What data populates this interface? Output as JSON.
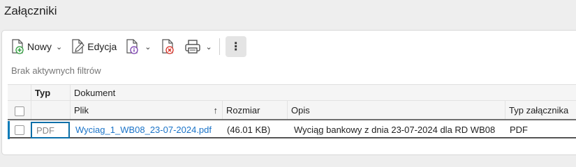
{
  "page": {
    "title": "Załączniki"
  },
  "toolbar": {
    "new_label": "Nowy",
    "edit_label": "Edycja",
    "accent": "#2e9e3c",
    "delete_color": "#d93025",
    "info_color": "#7b3fb0"
  },
  "filters": {
    "text": "Brak aktywnych filtrów"
  },
  "grid": {
    "group_header_type": "Typ",
    "group_header_document": "Dokument",
    "columns": {
      "file": "Plik",
      "size": "Rozmiar",
      "description": "Opis",
      "attachment_type": "Typ załącznika"
    },
    "rows": [
      {
        "type": "PDF",
        "file": "Wyciag_1_WB08_23-07-2024.pdf",
        "size": "(46.01 KB)",
        "description": "Wyciąg bankowy z dnia 23-07-2024 dla RD WB08",
        "attachment_type": "PDF"
      }
    ],
    "selection_color": "#0b6fa8",
    "link_color": "#1a73c8"
  }
}
